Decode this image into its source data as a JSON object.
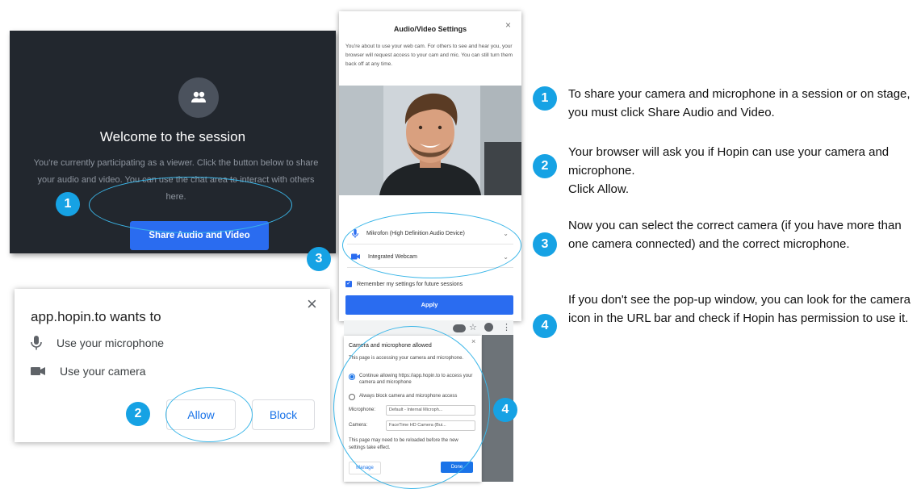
{
  "welcome": {
    "title": "Welcome to the session",
    "description": "You're currently participating as a viewer. Click the button below to share your audio and video. You can use the chat area to interact with others here.",
    "share_button": "Share Audio and Video",
    "avatar_icon": "users-icon"
  },
  "permission": {
    "heading": "app.hopin.to wants to",
    "microphone": "Use your microphone",
    "camera": "Use your camera",
    "allow": "Allow",
    "block": "Block",
    "close": "×"
  },
  "av_settings": {
    "title": "Audio/Video Settings",
    "description": "You're about to use your web cam. For others to see and hear you, your browser will request access to your cam and mic. You can still turn them back off at any time.",
    "close": "×",
    "microphone_select": "Mikrofon (High Definition Audio Device)",
    "camera_select": "Integrated Webcam",
    "remember": "Remember my settings for future sessions",
    "apply": "Apply"
  },
  "browser_popup": {
    "title": "Camera and microphone allowed",
    "text": "This page is accessing your camera and microphone.",
    "option_continue": "Continue allowing https://app.hopin.to to access your camera and microphone",
    "option_block": "Always block camera and microphone access",
    "microphone_label": "Microphone:",
    "microphone_value": "Default - Internal Microph...",
    "camera_label": "Camera:",
    "camera_value": "FaceTime HD Camera (Bui...",
    "reload_note": "This page may need to be reloaded before the new settings take effect.",
    "manage": "Manage",
    "done": "Done",
    "close": "×"
  },
  "badges": [
    "1",
    "2",
    "3",
    "4"
  ],
  "instructions": [
    {
      "num": "1",
      "text": "To share your camera and microphone in a session or on stage, you must click Share Audio and Video."
    },
    {
      "num": "2",
      "text": "Your browser will ask you if Hopin can use your camera and microphone.",
      "text2": "Click Allow."
    },
    {
      "num": "3",
      "text": "Now you can select the correct camera (if you have more than one camera connected) and the correct microphone."
    },
    {
      "num": "4",
      "text": "If you don't see the pop-up window, you can look for the camera icon in the URL bar and check if Hopin has permission to use it."
    }
  ],
  "colors": {
    "accent": "#16a2e4",
    "button_blue": "#2a6cf0",
    "dark_panel": "#22272e"
  }
}
